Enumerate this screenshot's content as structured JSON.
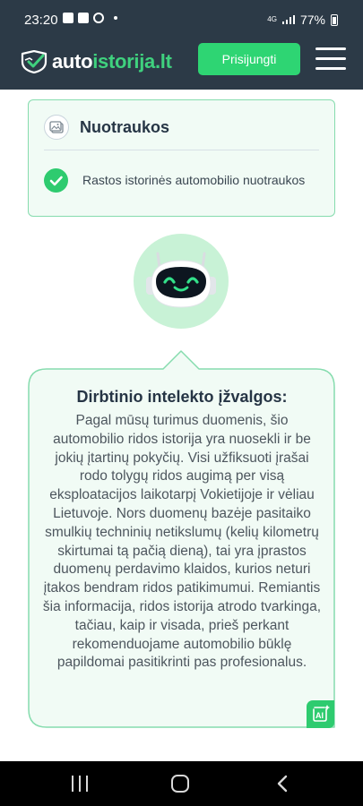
{
  "status_bar": {
    "time": "23:20",
    "network": "4G",
    "battery": "77%"
  },
  "header": {
    "logo_part1": "auto",
    "logo_part2": "istorija.lt",
    "login_label": "Prisijungti",
    "icons": [
      "logo-icon",
      "menu-icon"
    ]
  },
  "photos_card": {
    "title": "Nuotraukos",
    "item_text": "Rastos istorinės automobilio nuotraukos",
    "icons": [
      "photo-icon",
      "check-icon"
    ]
  },
  "ai_insights": {
    "title": "Dirbtinio intelekto įžvalgos:",
    "text": "Pagal mūsų turimus duomenis, šio automobilio ridos istorija yra nuoseklі ir be jokių įtartinų pokyčių. Visi užfiksuoti įrašai rodo tolygų ridos augimą per visą eksploatacijos laikotarpį Vokietijoje ir vėliau Lietuvoje. Nors duomenų bazėje pasitaiko smulkių techninių netikslumų (kelių kilometrų skirtumai tą pačią dieną), tai yra įprastos duomenų perdavimo klaidos, kurios neturi įtakos bendram ridos patikimumui. Remiantis šia informacija, ridos istorija atrodo tvarkinga, tačiau, kaip ir visada, prieš perkant rekomenduojame automobilio būklę papildomai pasitikrinti pas profesionalus.",
    "badge_label": "AI",
    "icons": [
      "robot-icon",
      "ai-badge-icon"
    ]
  },
  "nav_bar": {
    "icons": [
      "recents-icon",
      "home-icon",
      "back-icon"
    ]
  },
  "colors": {
    "header_bg": "#2c3a47",
    "accent_green": "#2ed573",
    "card_border": "#86dcae",
    "card_bg": "#f1fbf5"
  }
}
